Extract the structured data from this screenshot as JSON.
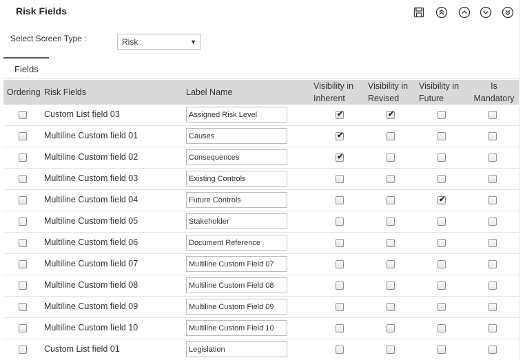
{
  "header": {
    "title": "Risk Fields"
  },
  "toolbar": {
    "buttons": [
      {
        "name": "save-icon"
      },
      {
        "name": "move-top-icon"
      },
      {
        "name": "move-up-icon"
      },
      {
        "name": "move-down-icon"
      },
      {
        "name": "move-bottom-icon"
      }
    ]
  },
  "screen_type": {
    "label": "Select Screen Type :",
    "value": "Risk"
  },
  "tabs": [
    {
      "label": "Fields"
    }
  ],
  "columns": {
    "ordering": "Ordering",
    "risk_fields": "Risk Fields",
    "label_name": "Label Name",
    "vis_inherent_1": "Visibility in",
    "vis_inherent_2": "Inherent",
    "vis_revised_1": "Visibility in",
    "vis_revised_2": "Revised",
    "vis_future_1": "Visibility in",
    "vis_future_2": "Future",
    "mandatory_1": "Is",
    "mandatory_2": "Mandatory"
  },
  "rows": [
    {
      "field": "Custom List field 03",
      "label": "Assigned Risk Level",
      "ordering": false,
      "inherent": true,
      "revised": true,
      "future": false,
      "mandatory": false
    },
    {
      "field": "Multiline Custom field 01",
      "label": "Causes",
      "ordering": false,
      "inherent": true,
      "revised": false,
      "future": false,
      "mandatory": false
    },
    {
      "field": "Multiline Custom field 02",
      "label": "Consequences",
      "ordering": false,
      "inherent": true,
      "revised": false,
      "future": false,
      "mandatory": false
    },
    {
      "field": "Multiline Custom field 03",
      "label": "Existing Controls",
      "ordering": false,
      "inherent": false,
      "revised": false,
      "future": false,
      "mandatory": false
    },
    {
      "field": "Multiline Custom field 04",
      "label": "Future Controls",
      "ordering": false,
      "inherent": false,
      "revised": false,
      "future": true,
      "mandatory": false
    },
    {
      "field": "Multiline Custom field 05",
      "label": "Stakeholder",
      "ordering": false,
      "inherent": false,
      "revised": false,
      "future": false,
      "mandatory": false
    },
    {
      "field": "Multiline Custom field 06",
      "label": "Document Reference",
      "ordering": false,
      "inherent": false,
      "revised": false,
      "future": false,
      "mandatory": false
    },
    {
      "field": "Multiline Custom field 07",
      "label": "Multiline Custom Field 07",
      "ordering": false,
      "inherent": false,
      "revised": false,
      "future": false,
      "mandatory": false
    },
    {
      "field": "Multiline Custom field 08",
      "label": "Multiline Custom Field 08",
      "ordering": false,
      "inherent": false,
      "revised": false,
      "future": false,
      "mandatory": false
    },
    {
      "field": "Multiline Custom field 09",
      "label": "Multiline Custom Field 09",
      "ordering": false,
      "inherent": false,
      "revised": false,
      "future": false,
      "mandatory": false
    },
    {
      "field": "Multiline Custom field 10",
      "label": "Multiline Custom Field 10",
      "ordering": false,
      "inherent": false,
      "revised": false,
      "future": false,
      "mandatory": false
    },
    {
      "field": "Custom List field 01",
      "label": "Legislation",
      "ordering": false,
      "inherent": false,
      "revised": false,
      "future": false,
      "mandatory": false
    }
  ]
}
